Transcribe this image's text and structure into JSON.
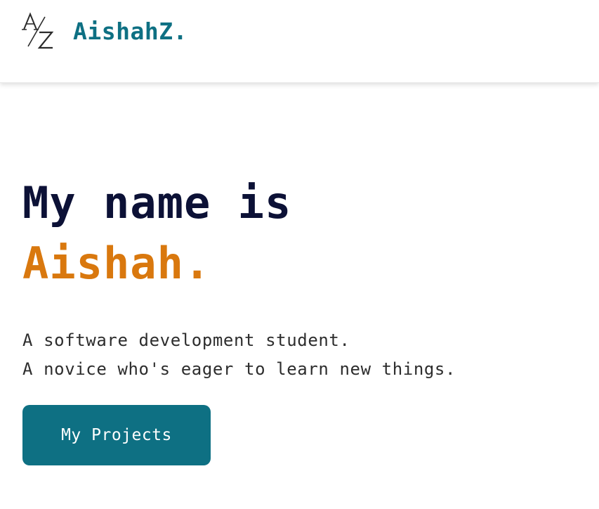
{
  "header": {
    "logo_letters": "A/Z",
    "brand": "AishahZ."
  },
  "hero": {
    "headline_line1": "My name is",
    "headline_line2": "Aishah.",
    "description": [
      "A software development student.",
      "A novice who's eager to learn new things."
    ],
    "cta_label": "My Projects"
  },
  "colors": {
    "brand_teal": "#0e7083",
    "accent_orange": "#d9780e",
    "heading_navy": "#0c1136",
    "body_text": "#2d2d2d"
  }
}
